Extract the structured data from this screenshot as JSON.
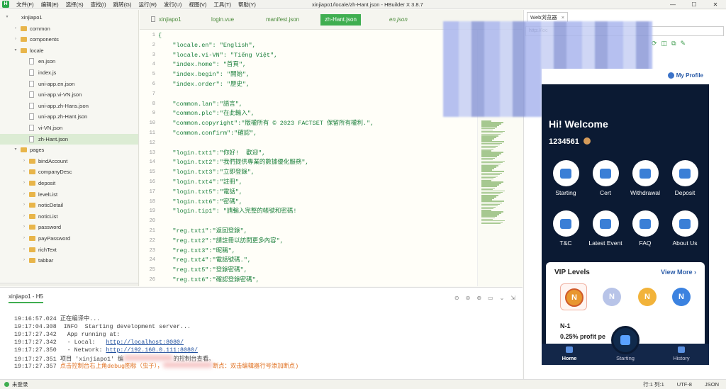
{
  "app": {
    "window_title": "xinjiapo1/locale/zh-Hant.json - HBuilder X 3.8.7",
    "menu": [
      "文件(F)",
      "编辑(E)",
      "选择(S)",
      "查找(I)",
      "跳转(G)",
      "运行(R)",
      "发行(U)",
      "视图(V)",
      "工具(T)",
      "帮助(Y)"
    ],
    "window_buttons": [
      "—",
      "☐",
      "✕"
    ]
  },
  "sidebar": {
    "items": [
      {
        "label": "xinjiapo1",
        "type": "root",
        "indent": 0,
        "arrow": "▾"
      },
      {
        "label": "common",
        "type": "folder",
        "indent": 1,
        "arrow": "›"
      },
      {
        "label": "components",
        "type": "folder",
        "indent": 1,
        "arrow": "›"
      },
      {
        "label": "locale",
        "type": "folder",
        "indent": 1,
        "arrow": "▾"
      },
      {
        "label": "en.json",
        "type": "file",
        "indent": 2,
        "arrow": ""
      },
      {
        "label": "index.js",
        "type": "file",
        "indent": 2,
        "arrow": ""
      },
      {
        "label": "uni-app.en.json",
        "type": "file",
        "indent": 2,
        "arrow": ""
      },
      {
        "label": "uni-app.vi-VN.json",
        "type": "file",
        "indent": 2,
        "arrow": ""
      },
      {
        "label": "uni-app.zh-Hans.json",
        "type": "file",
        "indent": 2,
        "arrow": ""
      },
      {
        "label": "uni-app.zh-Hant.json",
        "type": "file",
        "indent": 2,
        "arrow": ""
      },
      {
        "label": "vi-VN.json",
        "type": "file",
        "indent": 2,
        "arrow": ""
      },
      {
        "label": "zh-Hant.json",
        "type": "file",
        "indent": 2,
        "arrow": "",
        "selected": true
      },
      {
        "label": "pages",
        "type": "folder",
        "indent": 1,
        "arrow": "▾"
      },
      {
        "label": "bindAccount",
        "type": "folder",
        "indent": 2,
        "arrow": "›"
      },
      {
        "label": "companyDesc",
        "type": "folder",
        "indent": 2,
        "arrow": "›"
      },
      {
        "label": "deposit",
        "type": "folder",
        "indent": 2,
        "arrow": "›"
      },
      {
        "label": "levelList",
        "type": "folder",
        "indent": 2,
        "arrow": "›"
      },
      {
        "label": "noticDetail",
        "type": "folder",
        "indent": 2,
        "arrow": "›"
      },
      {
        "label": "noticList",
        "type": "folder",
        "indent": 2,
        "arrow": "›"
      },
      {
        "label": "password",
        "type": "folder",
        "indent": 2,
        "arrow": "›"
      },
      {
        "label": "payPassword",
        "type": "folder",
        "indent": 2,
        "arrow": "›"
      },
      {
        "label": "richText",
        "type": "folder",
        "indent": 2,
        "arrow": "›"
      },
      {
        "label": "tabbar",
        "type": "folder",
        "indent": 2,
        "arrow": "›"
      }
    ]
  },
  "tabs": [
    {
      "label": "xinjiapo1",
      "active": false
    },
    {
      "label": "login.vue",
      "active": false
    },
    {
      "label": "manifest.json",
      "active": false
    },
    {
      "label": "zh-Hant.json",
      "active": true
    },
    {
      "label": "en.json",
      "active": false
    }
  ],
  "editor": {
    "lines": [
      {
        "n": "1",
        "text": "{"
      },
      {
        "n": "2",
        "text": "    \"locale.en\": \"English\","
      },
      {
        "n": "3",
        "text": "    \"locale.vi-VN\": \"Tiếng Việt\","
      },
      {
        "n": "4",
        "text": "    \"index.home\": \"首頁\","
      },
      {
        "n": "5",
        "text": "    \"index.begin\": \"開始\","
      },
      {
        "n": "6",
        "text": "    \"index.order\": \"歷史\","
      },
      {
        "n": "7",
        "text": ""
      },
      {
        "n": "8",
        "text": "    \"common.lan\":\"語言\","
      },
      {
        "n": "9",
        "text": "    \"common.plc\":\"在此輸入\","
      },
      {
        "n": "10",
        "text": "    \"common.copyright\":\"版權所有 © 2023 FACTSET 保留所有權利.\","
      },
      {
        "n": "11",
        "text": "    \"common.confirm\":\"確認\","
      },
      {
        "n": "12",
        "text": ""
      },
      {
        "n": "13",
        "text": "    \"login.txt1\":\"你好!  歡迎\","
      },
      {
        "n": "14",
        "text": "    \"login.txt2\":\"我們提供專業的數據優化服務\","
      },
      {
        "n": "15",
        "text": "    \"login.txt3\":\"立即登錄\","
      },
      {
        "n": "16",
        "text": "    \"login.txt4\":\"註冊\","
      },
      {
        "n": "17",
        "text": "    \"login.txt5\":\"電話\","
      },
      {
        "n": "18",
        "text": "    \"login.txt6\":\"密碼\","
      },
      {
        "n": "19",
        "text": "    \"login.tip1\": \"請輸入完整的帳號和密碼!"
      },
      {
        "n": "20",
        "text": ""
      },
      {
        "n": "21",
        "text": "    \"reg.txt1\":\"返回登錄\","
      },
      {
        "n": "22",
        "text": "    \"reg.txt2\":\"請註冊以訪問更多內容\","
      },
      {
        "n": "23",
        "text": "    \"reg.txt3\":\"昵稱\","
      },
      {
        "n": "24",
        "text": "    \"reg.txt4\":\"電話號碼.\","
      },
      {
        "n": "25",
        "text": "    \"reg.txt5\":\"登錄密碼\","
      },
      {
        "n": "26",
        "text": "    \"reg.txt6\":\"確認登錄密碼\","
      }
    ]
  },
  "browser": {
    "tab_label": "Web浏览器",
    "tab_close": "×",
    "url": "http://loc",
    "tool_icons": [
      "⟳",
      "◫",
      "⧉",
      "✎"
    ]
  },
  "phone": {
    "profile_label": "My Profile",
    "welcome": "Hi! Welcome",
    "user_id": "1234561",
    "quick_actions": [
      "Starting",
      "Cert",
      "Withdrawal",
      "Deposit",
      "T&C",
      "Latest Event",
      "FAQ",
      "About Us"
    ],
    "vip_title": "VIP Levels",
    "vip_more": "View More ›",
    "vip_badges": [
      "N",
      "N",
      "N",
      "N"
    ],
    "level_name": "N-1",
    "profit": "0.25% profit pe",
    "tabbar": [
      "Home",
      "Starting",
      "History"
    ]
  },
  "console": {
    "tab_label": "xinjiapo1 - H5",
    "icons": [
      "⊝",
      "⊜",
      "⊕",
      "▭",
      "⌄",
      "⇲"
    ],
    "lines": [
      {
        "time": "19:16:57.024",
        "text": "正在编译中..."
      },
      {
        "time": "19:17:04.308",
        "text": " INFO  Starting development server..."
      },
      {
        "time": "19:17:27.342",
        "text": "  App running at:"
      },
      {
        "time": "19:17:27.342",
        "text": "  - Local:   ",
        "link": "http://localhost:8080/"
      },
      {
        "time": "19:17:27.350",
        "text": "  - Network: ",
        "link": "http://192.168.0.111:8080/"
      },
      {
        "time": "19:17:27.351",
        "text": "项目 'xinjiapo1' 编",
        "tail": "的控制台查看。"
      },
      {
        "time": "19:17:27.357",
        "text": "点击控制台右上角debug图标（虫子），",
        "tail": "断点：双击编辑器行号添加断点)",
        "warn": true
      }
    ]
  },
  "statusbar": {
    "login": "未登录",
    "row_col": "行:1  列:1",
    "encoding": "UTF-8",
    "lang": "JSON"
  }
}
